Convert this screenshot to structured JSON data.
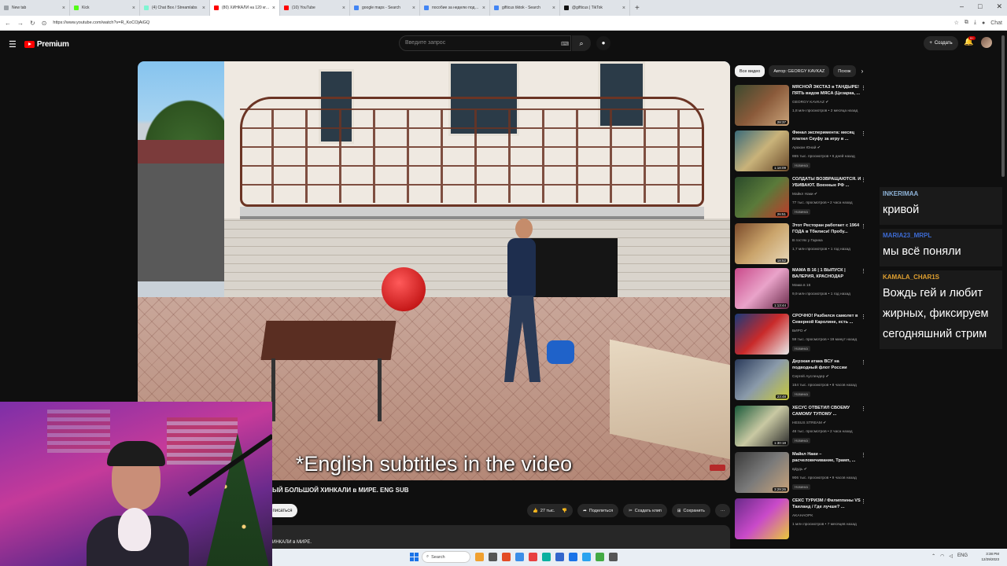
{
  "browser": {
    "tabs": [
      {
        "title": "New tab",
        "color": "#9aa0a6"
      },
      {
        "title": "Kick",
        "color": "#53fc18"
      },
      {
        "title": "(4) Chat Box / Streamlabs",
        "color": "#80f5d2"
      },
      {
        "title": "(80) ХИНКАЛИ на 120 кг. Моя ПР",
        "color": "#ff0000",
        "active": true
      },
      {
        "title": "(10) YouTube",
        "color": "#ff0000"
      },
      {
        "title": "google maps - Search",
        "color": "#4285f4"
      },
      {
        "title": "пособие за неделю подготовления - Se",
        "color": "#4285f4"
      },
      {
        "title": "gifticus tiktok - Search",
        "color": "#4285f4"
      },
      {
        "title": "@gifticus | TikTok",
        "color": "#111111"
      }
    ],
    "new_tab": "+",
    "url": "https://www.youtube.com/watch?v=R_KoCOjAiGQ",
    "window_controls": [
      "–",
      "□",
      "✕"
    ],
    "profile_label": "Chat"
  },
  "youtube": {
    "logo_text": "Premium",
    "search_placeholder": "Введите запрос",
    "create_label": "Создать",
    "notif_count": "9+",
    "video": {
      "subtitle": "*English subtitles in the video",
      "title": "ЫЙ БОЛЬШОЙ ХИНКАЛИ в МИРЕ. ENG SUB",
      "subscribe": "писаться",
      "likes": "27 тыс.",
      "share": "Поделиться",
      "clip": "Создать клип",
      "save": "Сохранить",
      "more": "···",
      "description": "ИНКАЛИ в МИРЕ."
    },
    "chips": [
      {
        "label": "Все видео",
        "active": true
      },
      {
        "label": "Автор: GEORGY KAVKAZ",
        "active": false
      },
      {
        "label": "Похож",
        "active": false
      }
    ],
    "chip_arrow": "›",
    "recommendations": [
      {
        "title": "МЯСНОЙ ЭКСТАЗ в ТАНДЫРЕ! ПЯТЬ видов МЯСА (Цезарка, ...",
        "channel": "GEORGY KAVKAZ ✔",
        "meta": "1,8 млн просмотров • 2 месяца назад",
        "duration": "28:37",
        "badge": "",
        "thumb": "linear-gradient(135deg,#3d4a2f,#8a5a3a 50%,#c9a37a)"
      },
      {
        "title": "Финал эксперимента: месяц платил Скуфу за игру в ...",
        "channel": "Арахан Юнай ✔",
        "meta": "865 тыс. просмотров • 6 дней назад",
        "duration": "1:18:09",
        "badge": "Новинка",
        "thumb": "linear-gradient(135deg,#3a6b7a,#c9b37a 50%,#6a4a2a)"
      },
      {
        "title": "СОЛДАТЫ ВОЗВРАЩАЮТСЯ. И УБИВАЮТ. Военные РФ ...",
        "channel": "Майкл Наки ✔",
        "meta": "77 тыс. просмотров • 2 часа назад",
        "duration": "26:51",
        "badge": "Новинка",
        "thumb": "linear-gradient(135deg,#2a4a2a,#5a7a3a 50%,#c03a2a)"
      },
      {
        "title": "Этот Ресторан работает с 1964 ГОДА в Тбилиси! Пробу...",
        "channel": "В гостях у Гарика",
        "meta": "1,7 млн просмотров • 1 год назад",
        "duration": "18:52",
        "badge": "",
        "thumb": "linear-gradient(135deg,#7a4a2a,#c9a36a 50%,#e9d9b9)"
      },
      {
        "title": "МАМА В 16 | 1 ВЫПУСК | ВАЛЕРИЯ, КРАСНОДАР",
        "channel": "Мама в 16",
        "meta": "9,9 млн просмотров • 1 год назад",
        "duration": "1:13:44",
        "badge": "",
        "thumb": "linear-gradient(135deg,#c94a8a,#e9a3c9 50%,#6a2a4a)"
      },
      {
        "title": "СРОЧНО! Разбился самолет в Северной Каролине, есть ...",
        "channel": "БИРО ✔",
        "meta": "59 тыс. просмотров • 19 минут назад",
        "duration": "",
        "badge": "Новинка",
        "thumb": "linear-gradient(135deg,#1a3a7a,#c92a2a 50%,#e9e9e9)"
      },
      {
        "title": "Дерзкая атака ВСУ на подводный флот России",
        "channel": "Сергей Ауслендер ✔",
        "meta": "154 тыс. просмотров • 8 часов назад",
        "duration": "23:48",
        "badge": "Новинка",
        "thumb": "linear-gradient(135deg,#2a3a5a,#8a9aaa 50%,#c9c93a)"
      },
      {
        "title": "ХЕСУС ОТВЕТИЛ СВОЕМУ САМОМУ ТУПОМУ ...",
        "channel": "HESUS STREAM ✔",
        "meta": "46 тыс. просмотров • 2 часа назад",
        "duration": "1:30:18",
        "badge": "Новинка",
        "thumb": "linear-gradient(135deg,#1a5a3a,#c9c9a3 50%,#2a2a2a)"
      },
      {
        "title": "Майкл Наки – расчеловечивание, Трамп, ...",
        "channel": "вДудь ✔",
        "meta": "906 тыс. просмотров • 9 часов назад",
        "duration": "3:29:26",
        "badge": "Новинка",
        "thumb": "linear-gradient(135deg,#3a3a3a,#7a7a7a 50%,#c9a37a)"
      },
      {
        "title": "СЕКС ТУРИЗМ / Филиппины VS Таиланд / Где лучше? ...",
        "channel": "AKAHAOPK",
        "meta": "1 млн просмотров • 7 месяцев назад",
        "duration": "",
        "badge": "",
        "thumb": "linear-gradient(135deg,#6a2a8a,#c94ac9 50%,#e9c93a)"
      }
    ]
  },
  "chat": [
    {
      "user": "INKERIMAA",
      "color": "#8fb4d9",
      "msg": "кривой"
    },
    {
      "user": "MARIA23_MRPL",
      "color": "#3d6bd4",
      "msg": "мы всё поняли"
    },
    {
      "user": "KAMALA_CHAR1S",
      "color": "#e0a030",
      "msg": "Вождь гей и любит жирных, фиксируем сегодняшний стрим"
    }
  ],
  "taskbar": {
    "search_label": "Search",
    "lang": "ENG",
    "time": "3:38 PM",
    "date": "12/29/2023",
    "icons": [
      "#f0a030",
      "#555555",
      "#e34c26",
      "#3b8ee8",
      "#e84040",
      "#0ab0a0",
      "#3366cc",
      "#1a73e8",
      "#2aa3ef",
      "#44aa44",
      "#555555"
    ]
  }
}
